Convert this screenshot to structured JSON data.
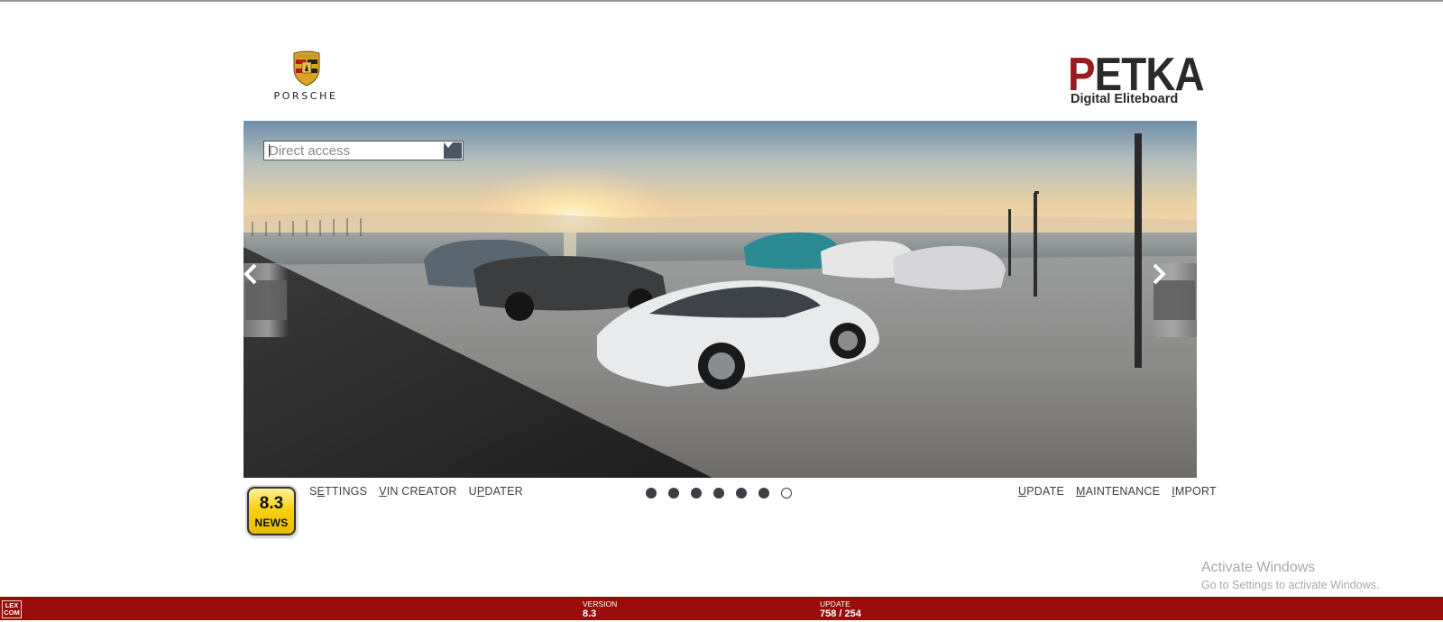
{
  "header": {
    "left_logo_text": "PORSCHE",
    "right_logo_main_first": "P",
    "right_logo_main_rest": "ETKA",
    "right_logo_subtitle": "Digital Eliteboard"
  },
  "search": {
    "placeholder": "Direct access",
    "dropdown_icon": "chevron-down-icon"
  },
  "carousel": {
    "prev_icon": "chevron-left-icon",
    "next_icon": "chevron-right-icon",
    "slide_count": 7,
    "active_slide_index": 6
  },
  "news": {
    "version": "8.3",
    "label": "NEWS"
  },
  "left_menu": [
    {
      "mnemonic": "",
      "mn_char": "",
      "rest": "SETTINGS",
      "full": "SETTINGS",
      "pre": "S",
      "u": "E",
      "post": "TTINGS"
    },
    {
      "pre": "",
      "u": "V",
      "post": "IN CREATOR"
    },
    {
      "pre": "U",
      "u": "P",
      "post": "DATER"
    }
  ],
  "right_menu": [
    {
      "pre": "",
      "u": "U",
      "post": "PDATE"
    },
    {
      "pre": "",
      "u": "M",
      "post": "AINTENANCE"
    },
    {
      "pre": "",
      "u": "I",
      "post": "MPORT"
    }
  ],
  "watermark": {
    "title": "Activate Windows",
    "subtitle": "Go to Settings to activate Windows."
  },
  "status_bar": {
    "brand": "LEX COM",
    "brand_line1": "LEX",
    "brand_line2": "COM",
    "version_label": "VERSION",
    "version_value": "8.3",
    "update_label": "UPDATE",
    "update_value": "758 / 254"
  },
  "colors": {
    "status_bar": "#9a0b0b",
    "petka_red": "#9a1b1f",
    "news_yellow": "#f7d312",
    "menu_text": "#3a3f48"
  }
}
